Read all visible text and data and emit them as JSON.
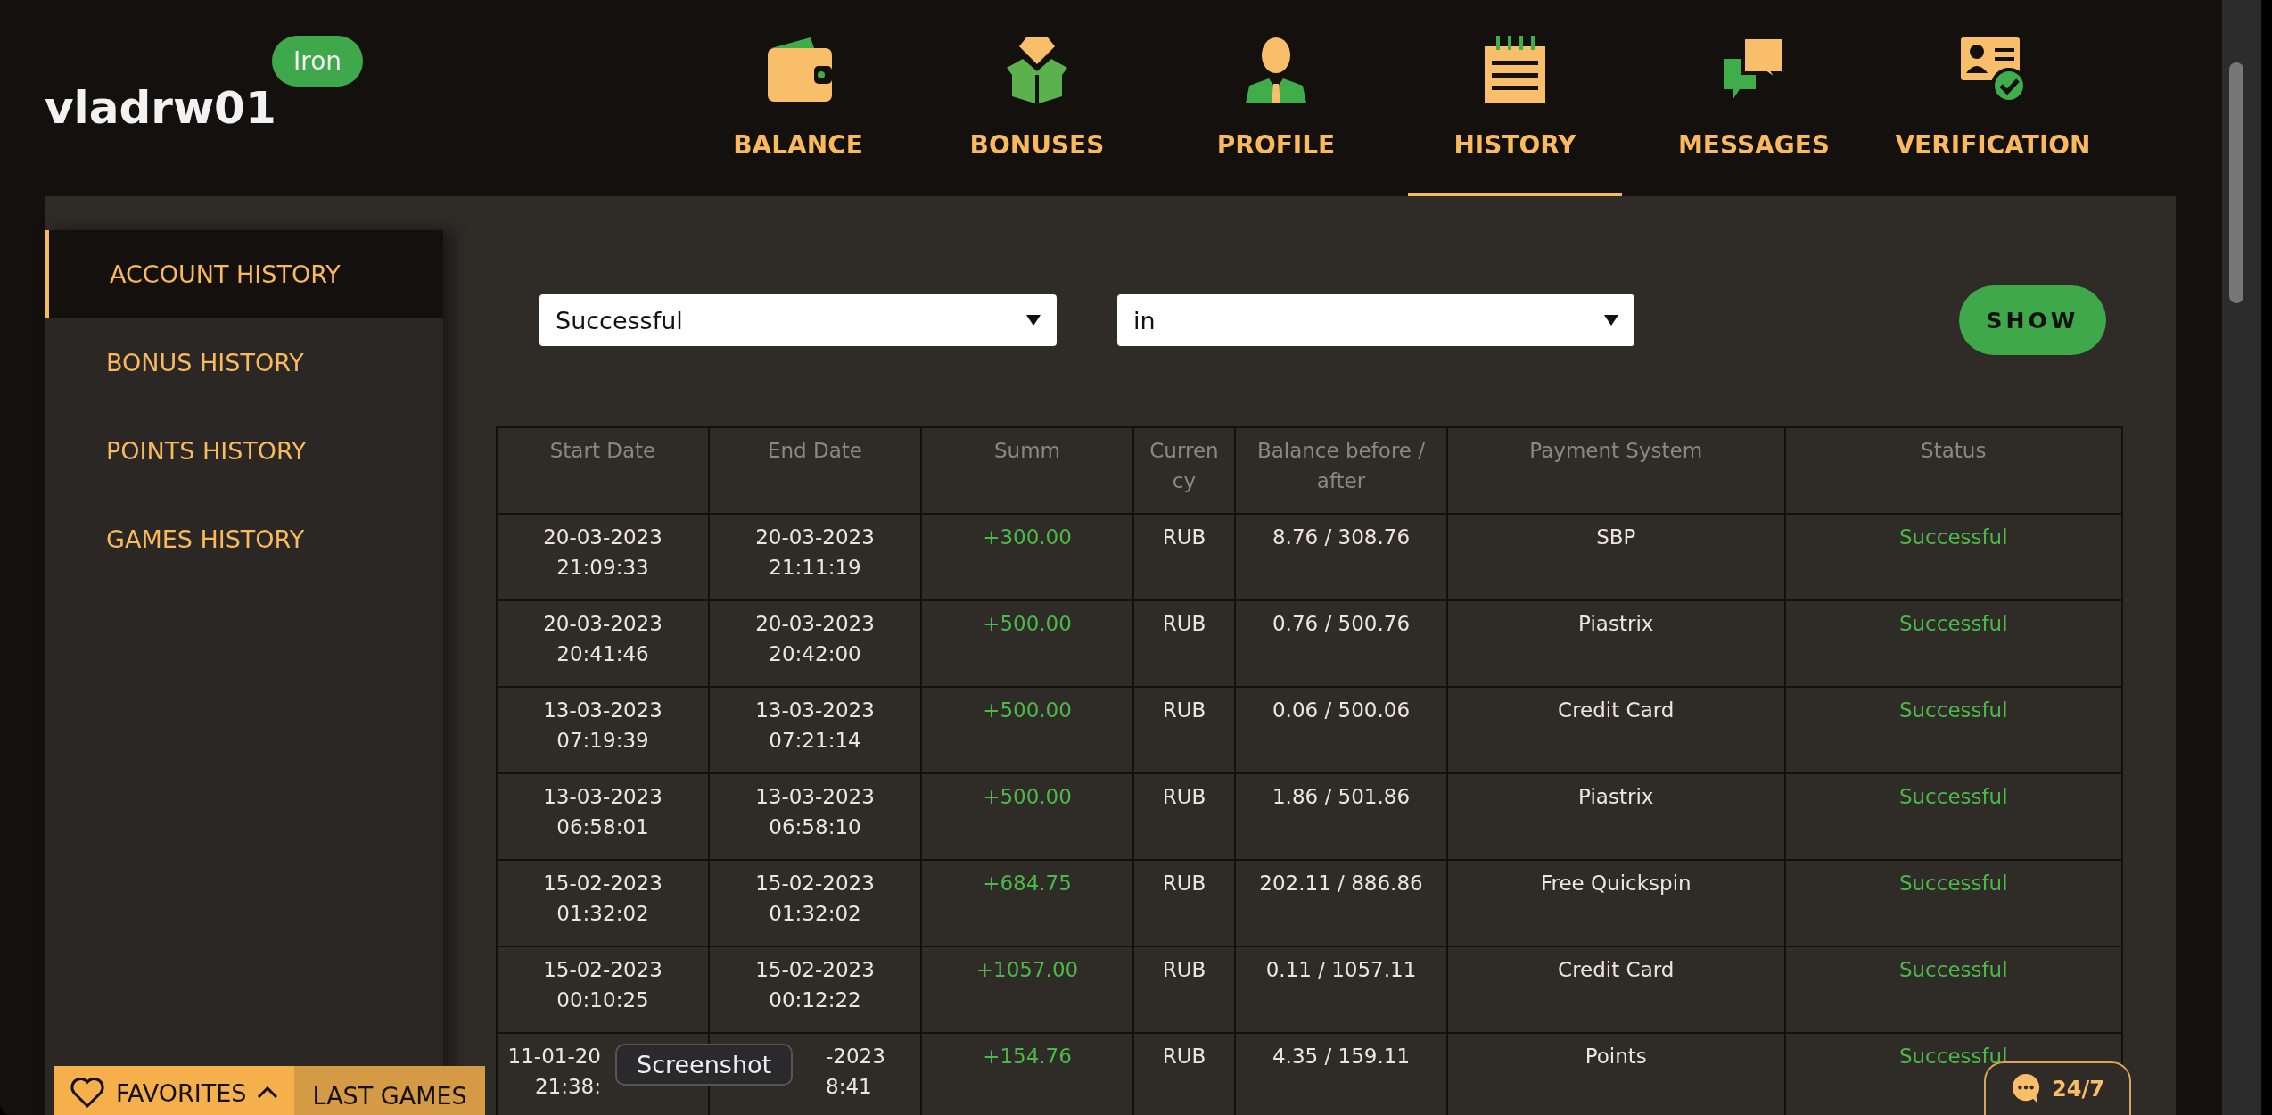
{
  "user": {
    "name": "vladrw01",
    "level_badge": "Iron"
  },
  "nav": [
    {
      "kind": "wallet",
      "label": "BALANCE",
      "selected": false
    },
    {
      "kind": "gift",
      "label": "BONUSES",
      "selected": false
    },
    {
      "kind": "person",
      "label": "PROFILE",
      "selected": false
    },
    {
      "kind": "notepad",
      "label": "HISTORY",
      "selected": true
    },
    {
      "kind": "chat",
      "label": "MESSAGES",
      "selected": false
    },
    {
      "kind": "idcard",
      "label": "VERIFICATION",
      "selected": false
    }
  ],
  "sidebar": {
    "items": [
      {
        "label": "ACCOUNT HISTORY",
        "selected": true
      },
      {
        "label": "BONUS HISTORY",
        "selected": false
      },
      {
        "label": "POINTS HISTORY",
        "selected": false
      },
      {
        "label": "GAMES HISTORY",
        "selected": false
      }
    ]
  },
  "filters": {
    "status": "Successful",
    "direction": "in",
    "show_button": "SHOW"
  },
  "table": {
    "columns": [
      "Start Date",
      "End Date",
      "Summ",
      "Curren cy",
      "Balance before / after",
      "Payment System",
      "Status"
    ],
    "rows": [
      {
        "covered": false,
        "start": [
          "20-03-2023",
          "21:09:33"
        ],
        "end": [
          "20-03-2023",
          "21:11:19"
        ],
        "summ": "+300.00",
        "currency": "RUB",
        "balance": "8.76 / 308.76",
        "system": "SBP",
        "status": "Successful"
      },
      {
        "covered": false,
        "start": [
          "20-03-2023",
          "20:41:46"
        ],
        "end": [
          "20-03-2023",
          "20:42:00"
        ],
        "summ": "+500.00",
        "currency": "RUB",
        "balance": "0.76 / 500.76",
        "system": "Piastrix",
        "status": "Successful"
      },
      {
        "covered": false,
        "start": [
          "13-03-2023",
          "07:19:39"
        ],
        "end": [
          "13-03-2023",
          "07:21:14"
        ],
        "summ": "+500.00",
        "currency": "RUB",
        "balance": "0.06 / 500.06",
        "system": "Credit Card",
        "status": "Successful"
      },
      {
        "covered": false,
        "start": [
          "13-03-2023",
          "06:58:01"
        ],
        "end": [
          "13-03-2023",
          "06:58:10"
        ],
        "summ": "+500.00",
        "currency": "RUB",
        "balance": "1.86 / 501.86",
        "system": "Piastrix",
        "status": "Successful"
      },
      {
        "covered": false,
        "start": [
          "15-02-2023",
          "01:32:02"
        ],
        "end": [
          "15-02-2023",
          "01:32:02"
        ],
        "summ": "+684.75",
        "currency": "RUB",
        "balance": "202.11 / 886.86",
        "system": "Free Quickspin",
        "status": "Successful"
      },
      {
        "covered": false,
        "start": [
          "15-02-2023",
          "00:10:25"
        ],
        "end": [
          "15-02-2023",
          "00:12:22"
        ],
        "summ": "+1057.00",
        "currency": "RUB",
        "balance": "0.11 / 1057.11",
        "system": "Credit Card",
        "status": "Successful"
      },
      {
        "covered": true,
        "start": [
          "11-01-20",
          "21:38:"
        ],
        "end": [
          "-2023",
          "8:41"
        ],
        "summ": "+154.76",
        "currency": "RUB",
        "balance": "4.35 / 159.11",
        "system": "Points",
        "status": "Successful"
      }
    ]
  },
  "bottom_bar": {
    "favorites": "FAVORITES",
    "last_games": "LAST GAMES"
  },
  "support": {
    "label": "24/7"
  },
  "tooltip": "Screenshot"
}
